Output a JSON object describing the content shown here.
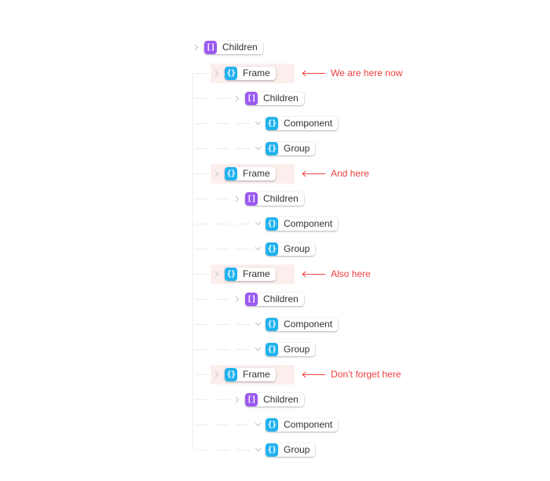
{
  "colors": {
    "object_badge": "#22b2ee",
    "array_badge": "#9b59f0",
    "highlight": "#fdeeee",
    "annotation": "#f03e3e"
  },
  "root": {
    "type": "array",
    "icon": "brackets-icon",
    "badge": "[ ]",
    "label": "Children",
    "chevron": "chevron-right-icon"
  },
  "groups": [
    {
      "frame": {
        "type": "object",
        "badge": "{ }",
        "label": "Frame",
        "chevron": "chevron-right-icon"
      },
      "annotation": "We are here now",
      "children": {
        "type": "array",
        "badge": "[ ]",
        "label": "Children",
        "chevron": "chevron-right-icon"
      },
      "items": [
        {
          "type": "object",
          "badge": "{ }",
          "label": "Component",
          "chevron": "chevron-down-icon"
        },
        {
          "type": "object",
          "badge": "{ }",
          "label": "Group",
          "chevron": "chevron-down-icon"
        }
      ]
    },
    {
      "frame": {
        "type": "object",
        "badge": "{ }",
        "label": "Frame",
        "chevron": "chevron-right-icon"
      },
      "annotation": "And here",
      "children": {
        "type": "array",
        "badge": "[ ]",
        "label": "Children",
        "chevron": "chevron-right-icon"
      },
      "items": [
        {
          "type": "object",
          "badge": "{ }",
          "label": "Component",
          "chevron": "chevron-down-icon"
        },
        {
          "type": "object",
          "badge": "{ }",
          "label": "Group",
          "chevron": "chevron-down-icon"
        }
      ]
    },
    {
      "frame": {
        "type": "object",
        "badge": "{ }",
        "label": "Frame",
        "chevron": "chevron-right-icon"
      },
      "annotation": "Also here",
      "children": {
        "type": "array",
        "badge": "[ ]",
        "label": "Children",
        "chevron": "chevron-right-icon"
      },
      "items": [
        {
          "type": "object",
          "badge": "{ }",
          "label": "Component",
          "chevron": "chevron-down-icon"
        },
        {
          "type": "object",
          "badge": "{ }",
          "label": "Group",
          "chevron": "chevron-down-icon"
        }
      ]
    },
    {
      "frame": {
        "type": "object",
        "badge": "{ }",
        "label": "Frame",
        "chevron": "chevron-right-icon"
      },
      "annotation": "Don’t forget here",
      "children": {
        "type": "array",
        "badge": "[ ]",
        "label": "Children",
        "chevron": "chevron-right-icon"
      },
      "items": [
        {
          "type": "object",
          "badge": "{ }",
          "label": "Component",
          "chevron": "chevron-down-icon"
        },
        {
          "type": "object",
          "badge": "{ }",
          "label": "Group",
          "chevron": "chevron-down-icon"
        }
      ]
    }
  ]
}
